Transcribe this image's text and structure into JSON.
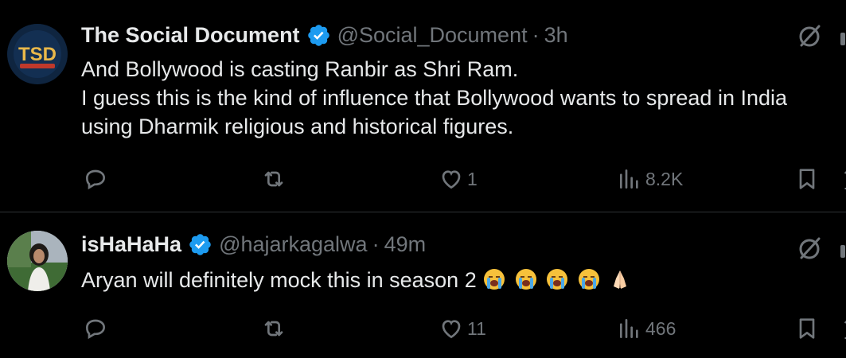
{
  "tweets": [
    {
      "display_name": "The Social Document",
      "handle": "@Social_Document",
      "separator": "·",
      "time": "3h",
      "avatar_text": "TSD",
      "text_lines": [
        "And Bollywood is casting Ranbir as Shri Ram.",
        "I guess this is the kind of influence that Bollywood wants to spread in India",
        "using Dharmik religious and historical figures."
      ],
      "stats": {
        "replies": "",
        "retweets": "",
        "likes": "1",
        "views": "8.2K"
      }
    },
    {
      "display_name": "isHaHaHa",
      "handle": "@hajarkagalwa",
      "separator": "·",
      "time": "49m",
      "text": "Aryan will definitely mock this in season 2",
      "emoji": [
        "loudly-crying-face",
        "loudly-crying-face",
        "loudly-crying-face",
        "loudly-crying-face",
        "folded-hands"
      ],
      "stats": {
        "replies": "",
        "retweets": "",
        "likes": "11",
        "views": "466"
      }
    }
  ],
  "colors": {
    "background": "#000000",
    "text_primary": "#e7e9ea",
    "text_secondary": "#71767b",
    "verified_blue": "#1d9bf0",
    "divider": "#2f3336"
  }
}
